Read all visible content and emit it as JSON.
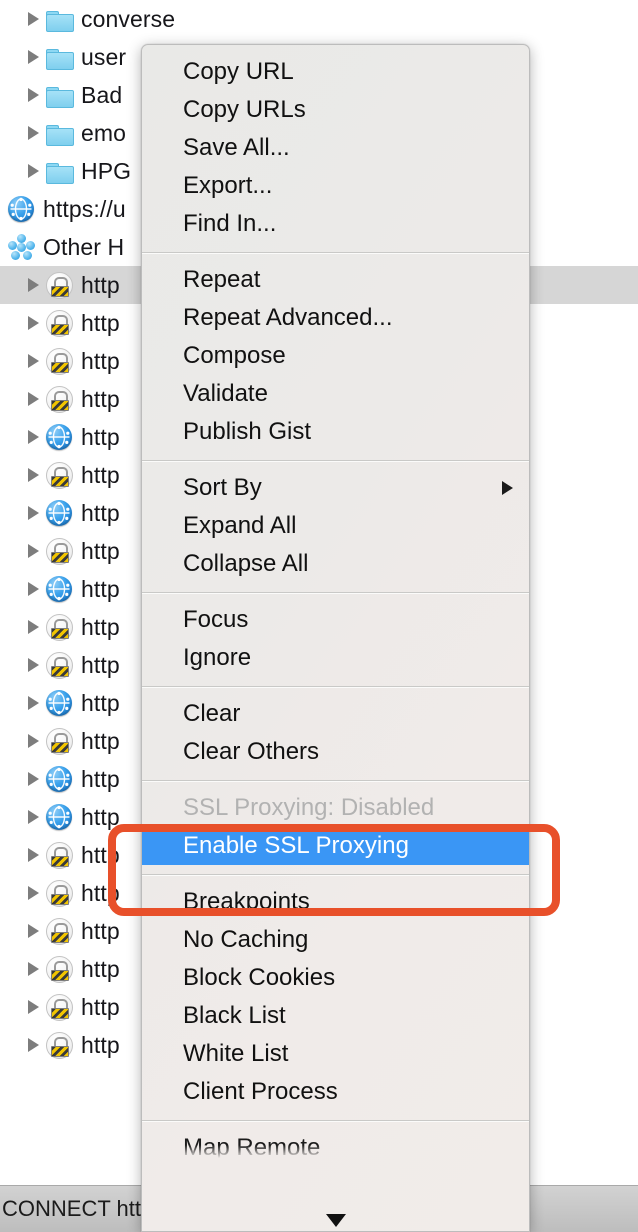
{
  "app": {
    "name": "Charles Proxy",
    "accent_blue": "#3a96f5",
    "annotation_color": "#e8502a",
    "menu_background": "#eceae8",
    "selected_row_color": "#d6d6d6"
  },
  "tree": {
    "rows": [
      {
        "label": "converse",
        "icon": "folder-icon",
        "disclosure": true,
        "selected": false
      },
      {
        "label": "user",
        "icon": "folder-icon",
        "disclosure": true,
        "selected": false
      },
      {
        "label": "Bad",
        "icon": "folder-icon",
        "disclosure": true,
        "selected": false
      },
      {
        "label": "emo",
        "icon": "folder-icon",
        "disclosure": true,
        "selected": false
      },
      {
        "label": "HPG",
        "icon": "folder-icon",
        "disclosure": true,
        "selected": false
      },
      {
        "label": "https://u",
        "icon": "globe-icon",
        "disclosure": false,
        "selected": false
      },
      {
        "label": "Other H",
        "icon": "cluster-icon",
        "disclosure": false,
        "selected": false
      },
      {
        "label": "http",
        "icon": "lock-icon",
        "disclosure": true,
        "selected": true
      },
      {
        "label": "http",
        "icon": "lock-icon",
        "disclosure": true,
        "selected": false
      },
      {
        "label": "http",
        "icon": "lock-icon",
        "disclosure": true,
        "selected": false
      },
      {
        "label": "http",
        "icon": "lock-icon",
        "disclosure": true,
        "selected": false
      },
      {
        "label": "http",
        "icon": "globe-icon",
        "disclosure": true,
        "selected": false
      },
      {
        "label": "http",
        "icon": "lock-icon",
        "disclosure": true,
        "selected": false
      },
      {
        "label": "http",
        "icon": "globe-icon",
        "disclosure": true,
        "selected": false
      },
      {
        "label": "http",
        "icon": "lock-icon",
        "disclosure": true,
        "selected": false
      },
      {
        "label": "http",
        "icon": "globe-icon",
        "disclosure": true,
        "selected": false
      },
      {
        "label": "http",
        "icon": "lock-icon",
        "disclosure": true,
        "selected": false
      },
      {
        "label": "http",
        "icon": "lock-icon",
        "disclosure": true,
        "selected": false
      },
      {
        "label": "http",
        "icon": "globe-icon",
        "disclosure": true,
        "selected": false
      },
      {
        "label": "http",
        "icon": "lock-icon",
        "disclosure": true,
        "selected": false
      },
      {
        "label": "http",
        "icon": "globe-icon",
        "disclosure": true,
        "selected": false
      },
      {
        "label": "http",
        "icon": "globe-icon",
        "disclosure": true,
        "selected": false
      },
      {
        "label": "http",
        "icon": "lock-icon",
        "disclosure": true,
        "selected": false
      },
      {
        "label": "http",
        "icon": "lock-icon",
        "disclosure": true,
        "selected": false
      },
      {
        "label": "http",
        "icon": "lock-icon",
        "disclosure": true,
        "selected": false
      },
      {
        "label": "http",
        "icon": "lock-icon",
        "disclosure": true,
        "selected": false
      },
      {
        "label": "http",
        "icon": "lock-icon",
        "disclosure": true,
        "selected": false
      },
      {
        "label": "http",
        "icon": "lock-icon",
        "disclosure": true,
        "selected": false
      }
    ]
  },
  "status_bar": {
    "text": "CONNECT http"
  },
  "context_menu": {
    "scroll_down_icon": "chevron-down-icon",
    "groups": [
      {
        "items": [
          {
            "label": "Copy URL",
            "state": "normal"
          },
          {
            "label": "Copy URLs",
            "state": "normal"
          },
          {
            "label": "Save All...",
            "state": "normal"
          },
          {
            "label": "Export...",
            "state": "normal"
          },
          {
            "label": "Find In...",
            "state": "normal"
          }
        ]
      },
      {
        "items": [
          {
            "label": "Repeat",
            "state": "normal"
          },
          {
            "label": "Repeat Advanced...",
            "state": "normal"
          },
          {
            "label": "Compose",
            "state": "normal"
          },
          {
            "label": "Validate",
            "state": "normal"
          },
          {
            "label": "Publish Gist",
            "state": "normal"
          }
        ]
      },
      {
        "items": [
          {
            "label": "Sort By",
            "state": "normal",
            "submenu": true
          },
          {
            "label": "Expand All",
            "state": "normal"
          },
          {
            "label": "Collapse All",
            "state": "normal"
          }
        ]
      },
      {
        "items": [
          {
            "label": "Focus",
            "state": "normal"
          },
          {
            "label": "Ignore",
            "state": "normal"
          }
        ]
      },
      {
        "items": [
          {
            "label": "Clear",
            "state": "normal"
          },
          {
            "label": "Clear Others",
            "state": "normal"
          }
        ]
      },
      {
        "items": [
          {
            "label": "SSL Proxying: Disabled",
            "state": "disabled"
          },
          {
            "label": "Enable SSL Proxying",
            "state": "highlighted"
          }
        ]
      },
      {
        "items": [
          {
            "label": "Breakpoints",
            "state": "normal"
          },
          {
            "label": "No Caching",
            "state": "normal"
          },
          {
            "label": "Block Cookies",
            "state": "normal"
          },
          {
            "label": "Black List",
            "state": "normal"
          },
          {
            "label": "White List",
            "state": "normal"
          },
          {
            "label": "Client Process",
            "state": "normal"
          }
        ]
      },
      {
        "items": [
          {
            "label": "Map Remote",
            "state": "faded"
          }
        ]
      }
    ]
  }
}
